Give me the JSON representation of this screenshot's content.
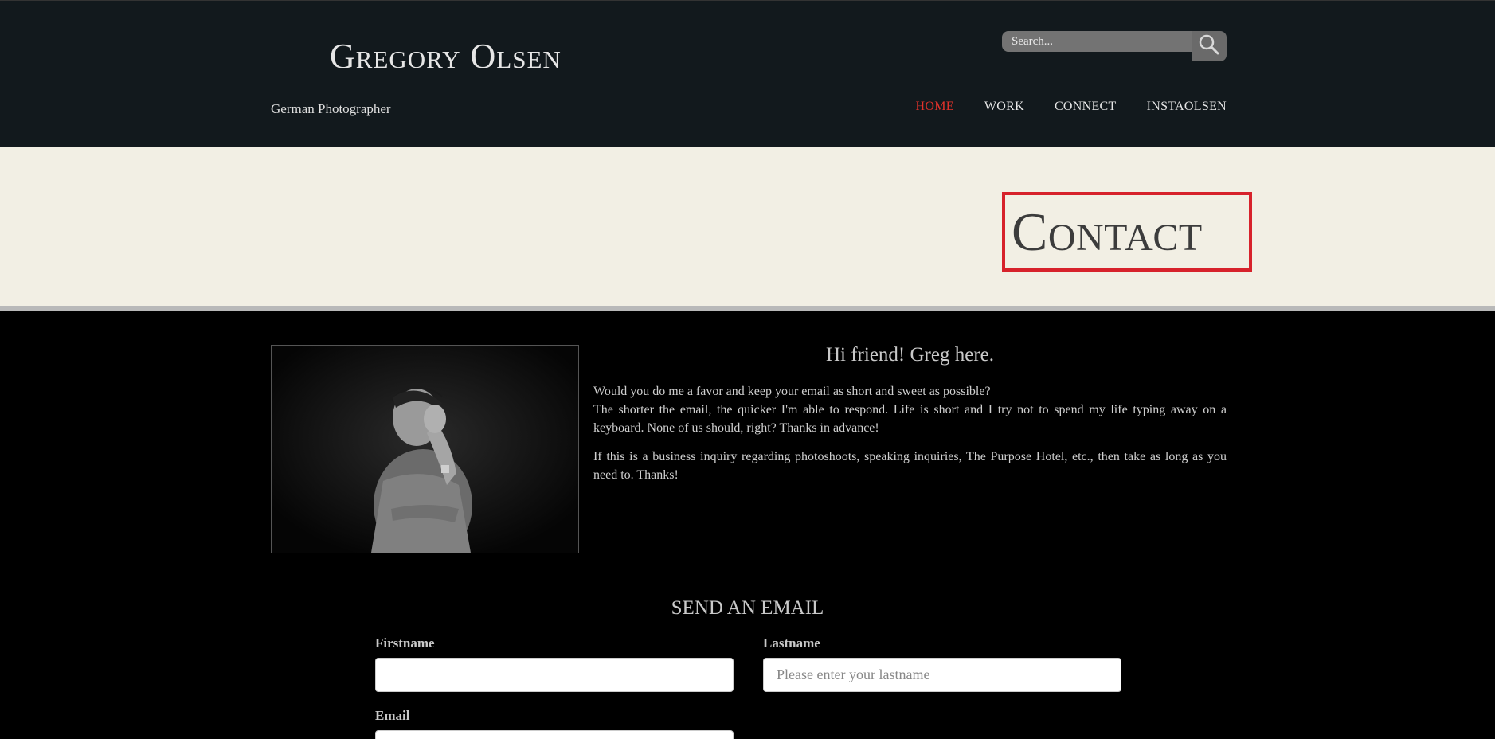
{
  "header": {
    "site_title": "Gregory Olsen",
    "tagline": "German Photographer",
    "search": {
      "placeholder": "Search..."
    },
    "nav": [
      {
        "label": "HOME",
        "active": true
      },
      {
        "label": "WORK",
        "active": false
      },
      {
        "label": "CONNECT",
        "active": false
      },
      {
        "label": "INSTAOLSEN",
        "active": false
      }
    ]
  },
  "hero": {
    "title": "Contact"
  },
  "intro": {
    "heading": "Hi friend! Greg here.",
    "paragraph1_line1": "Would you do me a favor and keep your email as short and sweet as possible?",
    "paragraph1_line2": "The shorter the email, the quicker I'm able to respond. Life is short and I try not to spend my life typing away on a keyboard. None of us should, right? Thanks in advance!",
    "paragraph2": "If this is a business inquiry regarding photoshoots, speaking inquiries, The Purpose Hotel, etc., then take as long as you need to. Thanks!"
  },
  "form": {
    "heading": "SEND AN EMAIL",
    "firstname_label": "Firstname",
    "firstname_value": "",
    "lastname_label": "Lastname",
    "lastname_placeholder": "Please enter your lastname",
    "email_label": "Email"
  },
  "colors": {
    "header_bg": "#12191d",
    "accent": "#e2322b",
    "hero_bg": "#f2efe4",
    "hero_border": "#d7222b"
  }
}
